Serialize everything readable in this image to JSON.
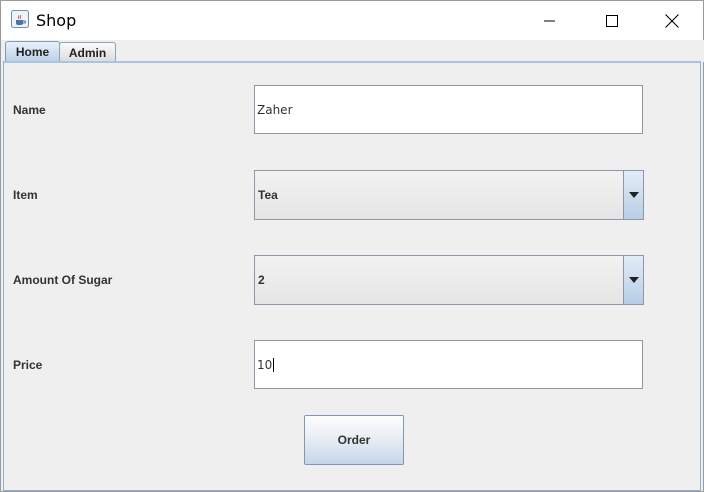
{
  "window": {
    "title": "Shop",
    "app_icon": "java-cup-icon",
    "controls": [
      "minimize-icon",
      "maximize-icon",
      "close-icon"
    ]
  },
  "tabs": [
    {
      "label": "Home",
      "selected": true
    },
    {
      "label": "Admin",
      "selected": false
    }
  ],
  "form": {
    "name_label": "Name",
    "name_value": "Zaher",
    "item_label": "Item",
    "item_value": "Tea",
    "sugar_label": "Amount Of Sugar",
    "sugar_value": "2",
    "price_label": "Price",
    "price_value": "10",
    "order_button": "Order"
  },
  "colors": {
    "accent": "#b9cfe7",
    "panel_border": "#92aecf",
    "background": "#f0efef"
  }
}
